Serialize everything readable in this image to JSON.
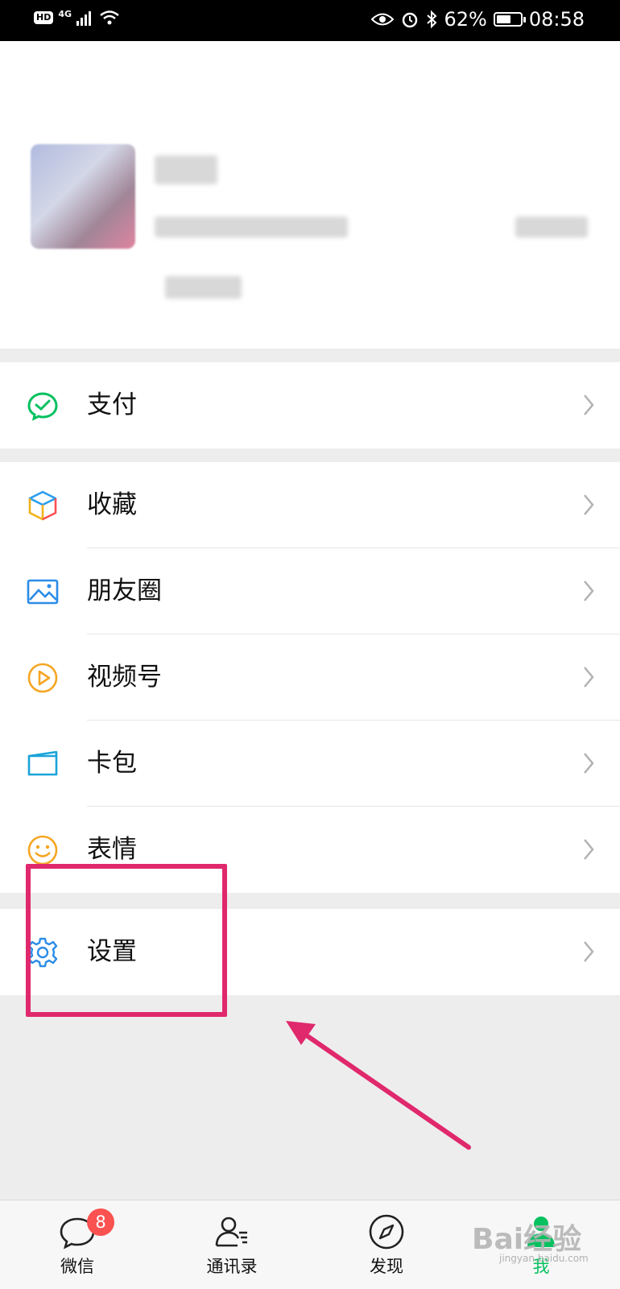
{
  "status_bar": {
    "hd": "HD",
    "network": "4G",
    "battery_percent": "62%",
    "battery_level": 0.62,
    "time": "08:58"
  },
  "menu": {
    "pay": {
      "label": "支付",
      "icon": "wechat-pay-icon"
    },
    "favorites": {
      "label": "收藏",
      "icon": "cube-icon"
    },
    "moments": {
      "label": "朋友圈",
      "icon": "image-icon"
    },
    "channels": {
      "label": "视频号",
      "icon": "play-icon"
    },
    "cards": {
      "label": "卡包",
      "icon": "card-icon"
    },
    "stickers": {
      "label": "表情",
      "icon": "smiley-icon"
    },
    "settings": {
      "label": "设置",
      "icon": "gear-icon"
    }
  },
  "tabbar": {
    "chats": {
      "label": "微信",
      "badge": "8",
      "icon": "chat-bubble-icon"
    },
    "contacts": {
      "label": "通讯录",
      "icon": "contacts-icon"
    },
    "discover": {
      "label": "发现",
      "icon": "compass-icon"
    },
    "me": {
      "label": "我",
      "icon": "person-icon"
    }
  },
  "watermark": {
    "text": "Bai经验",
    "sub": "jingyan.baidu.com"
  },
  "colors": {
    "accent_green": "#07c160",
    "highlight_pink": "#e0286d",
    "badge_red": "#fa5151"
  }
}
